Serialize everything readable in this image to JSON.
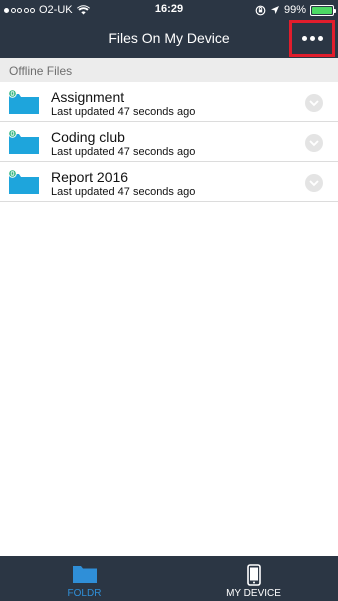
{
  "status_bar": {
    "carrier": "O2-UK",
    "time": "16:29",
    "battery": "99%",
    "battery_level": 0.99
  },
  "nav": {
    "title": "Files On My Device",
    "more_icon": "more-horizontal-icon"
  },
  "section": {
    "title": "Offline Files"
  },
  "files": [
    {
      "name": "Assignment",
      "meta": "Last updated 47 seconds ago"
    },
    {
      "name": "Coding club",
      "meta": "Last updated 47 seconds ago"
    },
    {
      "name": "Report 2016",
      "meta": "Last updated 47 seconds ago"
    }
  ],
  "tabs": [
    {
      "label": "FOLDR",
      "icon": "folder-icon",
      "active": true
    },
    {
      "label": "MY DEVICE",
      "icon": "phone-icon",
      "active": false
    }
  ],
  "colors": {
    "bar_bg": "#2b3644",
    "folder": "#1ea5dc",
    "badge": "#2fb37d",
    "highlight": "#e11d2c",
    "active_tab": "#2f8fd8"
  }
}
